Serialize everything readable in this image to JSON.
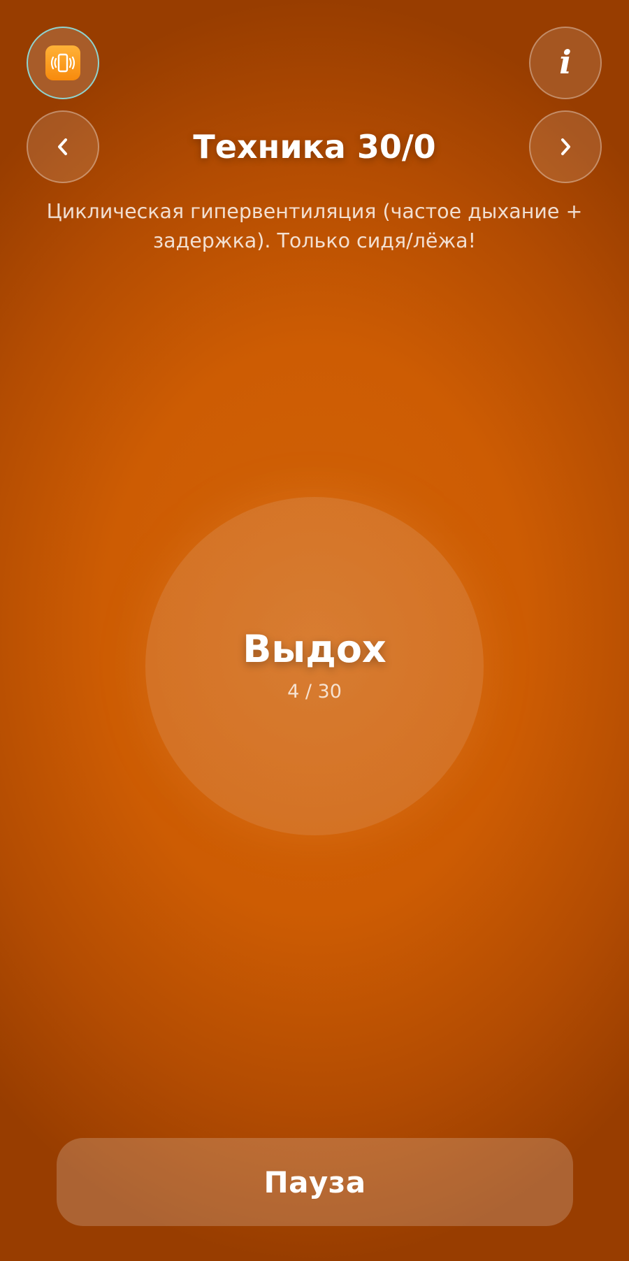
{
  "header": {
    "vibration_toggle": {
      "icon": "vibration-icon",
      "active": true
    },
    "info_button": {
      "glyph": "i",
      "icon": "info-icon"
    },
    "prev_button": {
      "glyph": "‹",
      "icon": "chevron-left-icon"
    },
    "next_button": {
      "glyph": "›",
      "icon": "chevron-right-icon"
    },
    "title": "Техника 30/0",
    "subtitle": "Циклическая гипервентиляция (частое дыхание + задержка). Только сидя/лёжа!"
  },
  "breath": {
    "phase": "Выдох",
    "counter": "4 / 30",
    "current": 4,
    "total": 30
  },
  "controls": {
    "pause_label": "Пауза"
  },
  "colors": {
    "background": "#cd5c03",
    "background_edge": "#983d00",
    "vibration_tile": "#f78a0d",
    "active_ring": "#8fd3cf"
  }
}
